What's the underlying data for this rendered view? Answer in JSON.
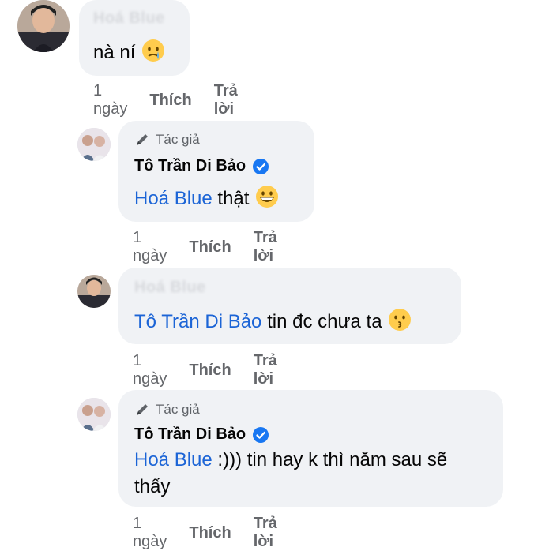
{
  "comments": [
    {
      "author": "Hoá Blue",
      "author_blurred": true,
      "text": "nà ní",
      "emoji": "crying-face",
      "time": "1 ngày",
      "like": "Thích",
      "reply": "Trả lời"
    },
    {
      "badge": "Tác giả",
      "author": "Tô Trần Di Bảo",
      "verified": true,
      "mention": "Hoá Blue",
      "text": "thật",
      "emoji": "grinning-face",
      "time": "1 ngày",
      "like": "Thích",
      "reply": "Trả lời"
    },
    {
      "author": "Hoá Blue",
      "author_blurred": true,
      "mention": "Tô Trần Di Bảo",
      "text": "tin đc chưa ta",
      "emoji": "kissing-face",
      "time": "1 ngày",
      "like": "Thích",
      "reply": "Trả lời"
    },
    {
      "badge": "Tác giả",
      "author": "Tô Trần Di Bảo",
      "verified": true,
      "mention": "Hoá Blue",
      "text_line1": ":))) tin hay k thì năm sau sẽ",
      "text_line2": "thấy",
      "time": "1 ngày",
      "like": "Thích",
      "reply": "Trả lời"
    }
  ],
  "colors": {
    "bubble": "#f0f2f5",
    "mention": "#1b64d6",
    "meta": "#65676b",
    "verified": "#1877f2"
  }
}
